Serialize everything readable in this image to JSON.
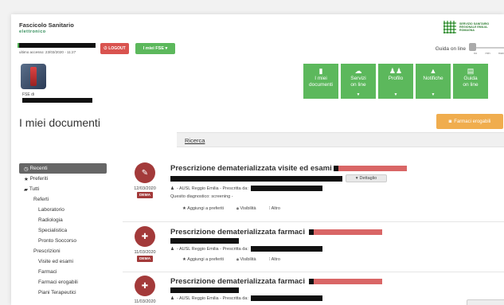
{
  "header": {
    "brand_line1": "Fascicolo Sanitario",
    "brand_line2": "elettronico",
    "region_text": "SERVIZIO SANITARIO REGIONALE EMILIA-ROMAGNA",
    "last_access": "ultimo accesso: 23/03/2020 - 11:27",
    "logout_label": "LOGOUT",
    "fse_label": "I miei FSE ▾",
    "guida_label": "Guida on line",
    "guida_ticks": [
      "no",
      "min",
      "max"
    ]
  },
  "profile": {
    "fse_di": "FSE di"
  },
  "page_title": "I miei documenti",
  "tiles": [
    {
      "label1": "I miei",
      "label2": "documenti",
      "icon": "document-icon",
      "glyph": "▮",
      "caret": false
    },
    {
      "label1": "Servizi",
      "label2": "on line",
      "icon": "cloud-icon",
      "glyph": "☁",
      "caret": true
    },
    {
      "label1": "Profilo",
      "label2": "",
      "icon": "users-icon",
      "glyph": "👥",
      "caret": true
    },
    {
      "label1": "Notifiche",
      "label2": "",
      "icon": "bell-icon",
      "glyph": "🔔",
      "caret": true
    },
    {
      "label1": "Guida",
      "label2": "on line",
      "icon": "guide-icon",
      "glyph": "▤",
      "caret": false
    }
  ],
  "farmaci_button": "Farmaci erogabili",
  "search_link": "Ricerca",
  "sidebar": [
    {
      "label": "Recenti",
      "icon": "◷",
      "level": "active"
    },
    {
      "label": "Preferiti",
      "icon": "★",
      "level": "lv0"
    },
    {
      "label": "Tutti",
      "icon": "▰",
      "level": "lv0"
    },
    {
      "label": "Referti",
      "icon": "",
      "level": "lv1"
    },
    {
      "label": "Laboratorio",
      "icon": "",
      "level": "lv2"
    },
    {
      "label": "Radiologia",
      "icon": "",
      "level": "lv2"
    },
    {
      "label": "Specialistica",
      "icon": "",
      "level": "lv2"
    },
    {
      "label": "Pronto Soccorso",
      "icon": "",
      "level": "lv2"
    },
    {
      "label": "Prescrizioni",
      "icon": "",
      "level": "lv1"
    },
    {
      "label": "Visite ed esami",
      "icon": "",
      "level": "lv2"
    },
    {
      "label": "Farmaci",
      "icon": "",
      "level": "lv2"
    },
    {
      "label": "Farmaci erogabili",
      "icon": "",
      "level": "lv2"
    },
    {
      "label": "Piani Terapeutici",
      "icon": "",
      "level": "lv2"
    }
  ],
  "documents": [
    {
      "title": "Prescrizione dematerializzata visite ed esami",
      "date": "12/03/2020",
      "badge": "DEMA",
      "meta": "- AUSL Reggio Emilia - Prescritta da:",
      "diagnosis": "Quesito diagnostico: screening -",
      "dettaglio": "Dettaglio",
      "actions": [
        "Aggiungi a preferiti",
        "Visibilità",
        "Altro"
      ]
    },
    {
      "title": "Prescrizione dematerializzata farmaci",
      "date": "11/03/2020",
      "badge": "DEMA",
      "meta": "- AUSL Reggio Emilia - Prescritta da:",
      "actions": [
        "Aggiungi a preferiti",
        "Visibilità",
        "Altro"
      ]
    },
    {
      "title": "Prescrizione dematerializzata farmaci",
      "date": "11/03/2020",
      "badge": "",
      "meta": "- AUSL Reggio Emilia - Prescritta da:"
    }
  ],
  "colors": {
    "green": "#5cb85c",
    "red_button": "#d9534f",
    "orange": "#f0ad4e",
    "doc_icon": "#a33a3a"
  }
}
